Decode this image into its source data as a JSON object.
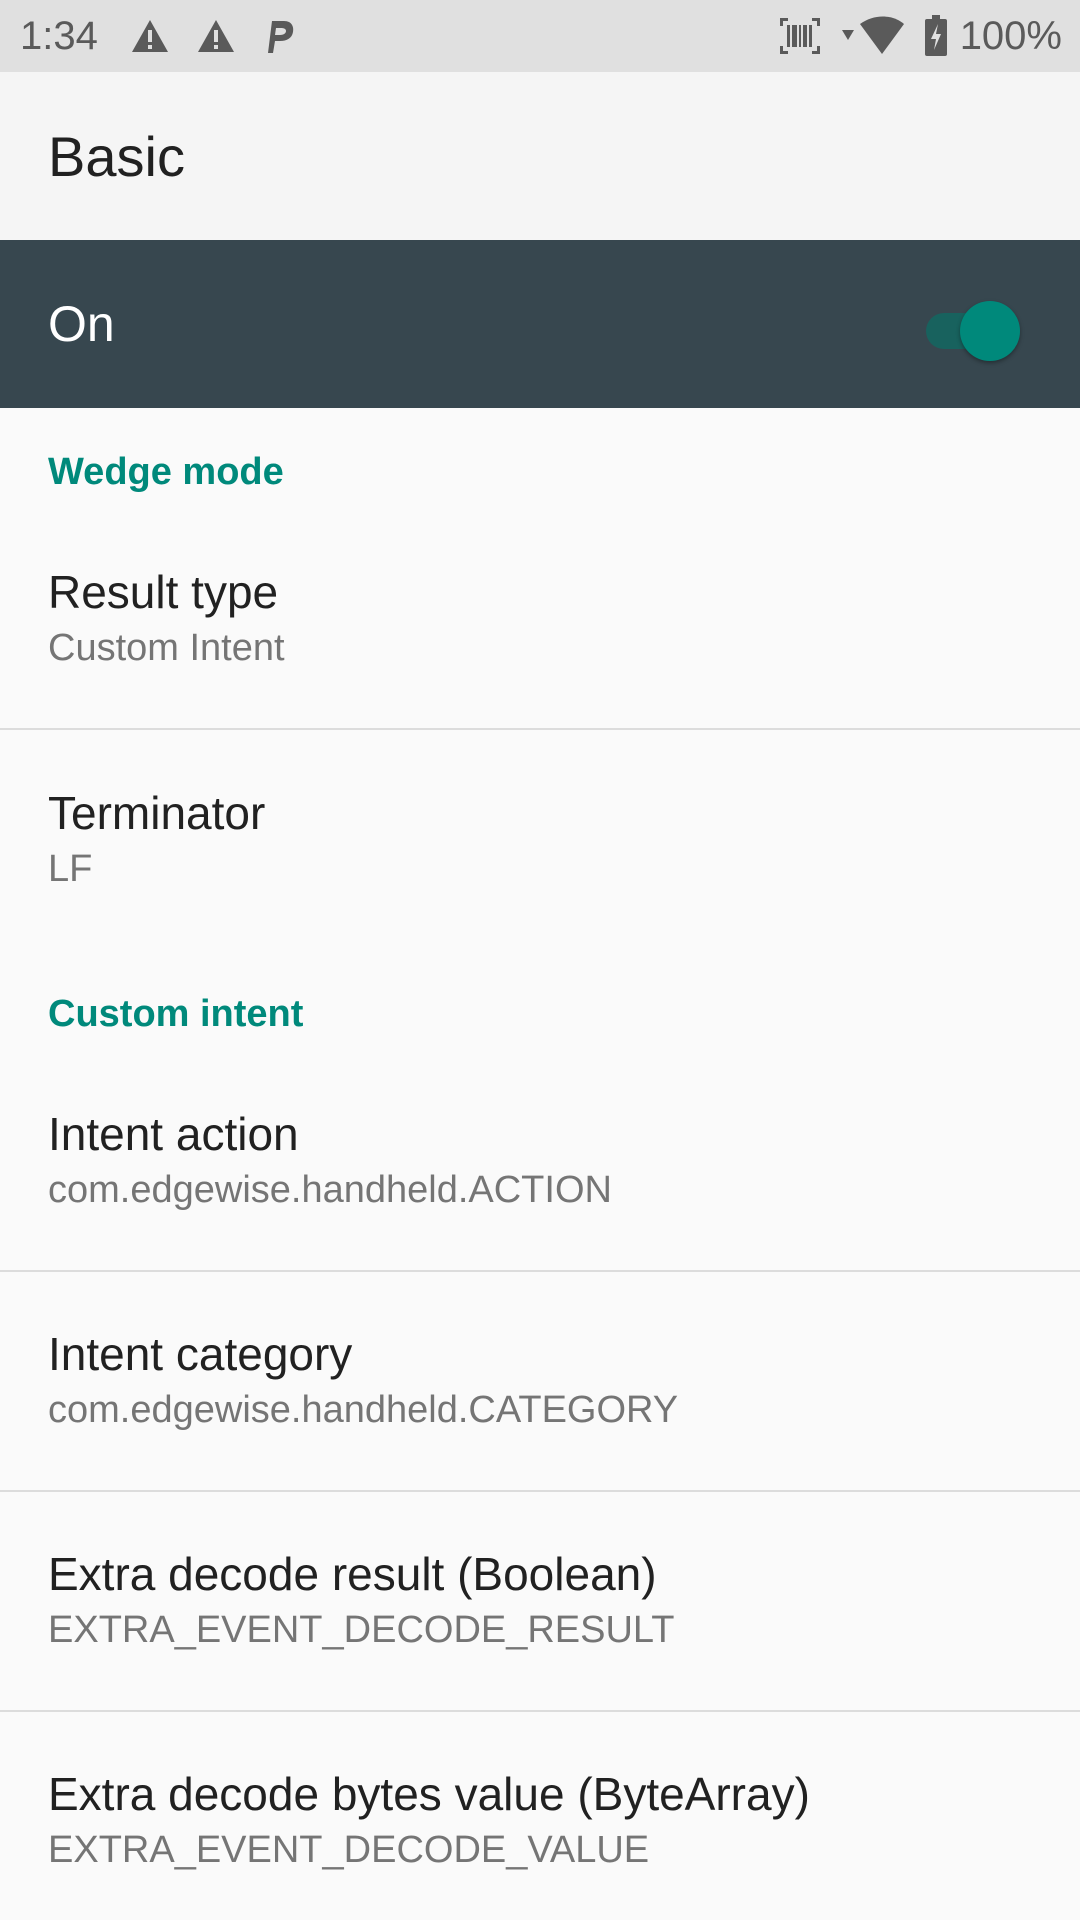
{
  "status_bar": {
    "time": "1:34",
    "left_icons": [
      "warning-icon",
      "warning-icon",
      "parking-icon"
    ],
    "right_icons": [
      "barcode-scanner-icon",
      "wifi-icon",
      "battery-charging-icon"
    ],
    "battery": "100%"
  },
  "app_bar": {
    "title": "Basic"
  },
  "master_switch": {
    "label": "On",
    "checked": true
  },
  "sections": [
    {
      "title": "Wedge mode",
      "items": [
        {
          "title": "Result type",
          "summary": "Custom Intent"
        },
        {
          "title": "Terminator",
          "summary": "LF"
        }
      ]
    },
    {
      "title": "Custom intent",
      "items": [
        {
          "title": "Intent action",
          "summary": "com.edgewise.handheld.ACTION"
        },
        {
          "title": "Intent category",
          "summary": "com.edgewise.handheld.CATEGORY"
        },
        {
          "title": "Extra decode result (Boolean)",
          "summary": "EXTRA_EVENT_DECODE_RESULT"
        },
        {
          "title": "Extra decode bytes value (ByteArray)",
          "summary": "EXTRA_EVENT_DECODE_VALUE"
        }
      ]
    }
  ],
  "colors": {
    "accent": "#00897b",
    "master_bar": "#37474f",
    "status_bar": "#e0e0e0"
  }
}
